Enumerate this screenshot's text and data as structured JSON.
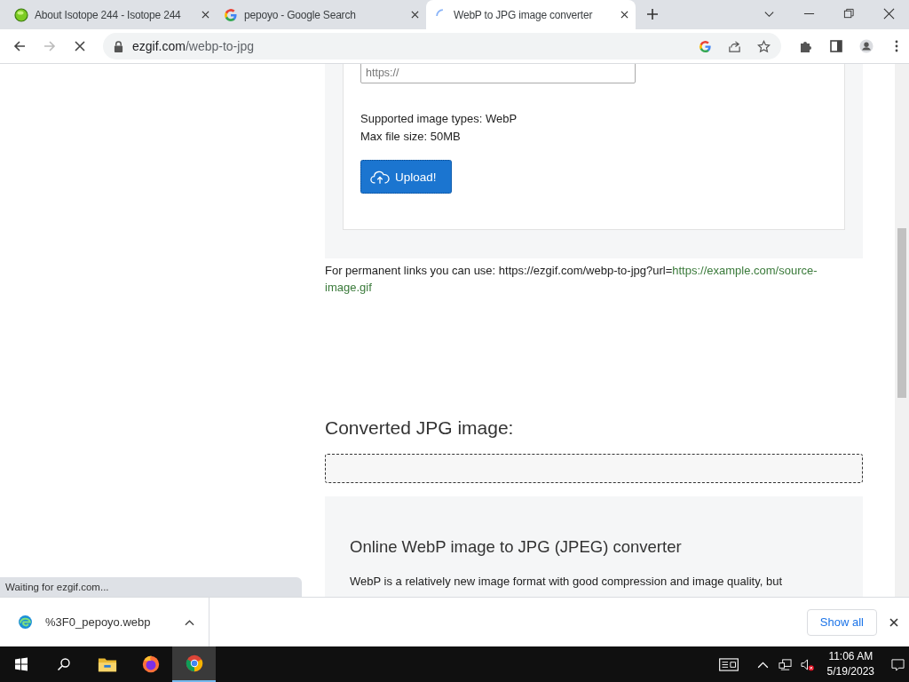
{
  "tabs": [
    {
      "title": "About Isotope 244 - Isotope 244",
      "kind": "green",
      "selected": false
    },
    {
      "title": "pepoyo - Google Search",
      "kind": "google",
      "selected": false
    },
    {
      "title": "WebP to JPG image converter",
      "kind": "loading",
      "selected": true
    }
  ],
  "address_bar": {
    "host": "ezgif.com",
    "path": "/webp-to-jpg"
  },
  "upload_form": {
    "url_placeholder": "https://",
    "supported": "Supported image types: WebP",
    "max_size": "Max file size: 50MB",
    "button": "Upload!"
  },
  "permanent_link": {
    "text": "For permanent links you can use: https://ezgif.com/webp-to-jpg?url=",
    "link": "https://example.com/source-image.gif"
  },
  "output": {
    "heading": "Converted JPG image:"
  },
  "info": {
    "heading": "Online WebP image to JPG (JPEG) converter",
    "paragraph": "WebP is a relatively new image format with good compression and image quality, but"
  },
  "status": "Waiting for ezgif.com...",
  "download_bar": {
    "file": "%3F0_pepoyo.webp",
    "show_all": "Show all"
  },
  "taskbar": {
    "apps": [
      {
        "kind": "explorer",
        "selected": false
      },
      {
        "kind": "firefox",
        "selected": false
      },
      {
        "kind": "chrome",
        "selected": true
      }
    ],
    "time": "11:06 AM",
    "date": "5/19/2023"
  }
}
